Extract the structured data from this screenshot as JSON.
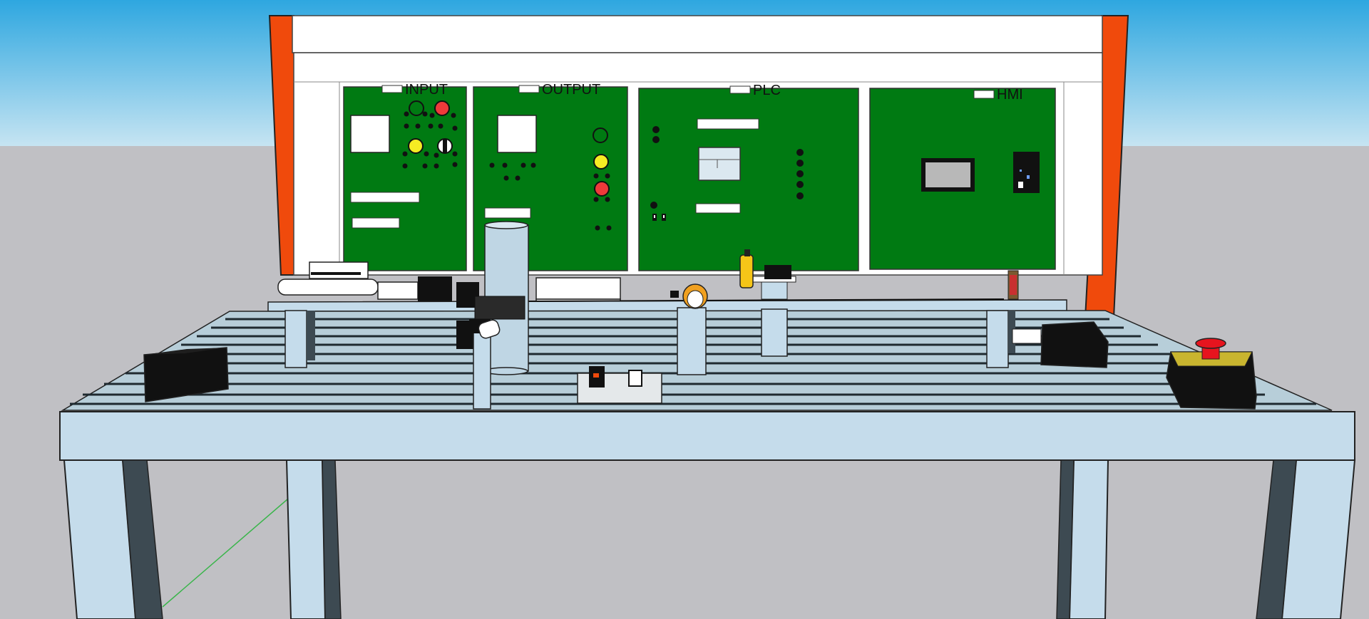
{
  "panels": [
    {
      "id": "input",
      "label": "INPUT"
    },
    {
      "id": "output",
      "label": "OUTPUT"
    },
    {
      "id": "plc",
      "label": "PLC"
    },
    {
      "id": "hmi",
      "label": "HMI"
    }
  ],
  "colors": {
    "sky_top": "#2ea7e0",
    "sky_bottom": "#bfe0f0",
    "ground": "#c0c0c4",
    "board_frame_side": "#f04a0c",
    "board_white": "#ffffff",
    "panel_green": "#007a12",
    "table_light": "#c5dceb",
    "table_dark": "#3d4a52",
    "lamp_red": "#ee3a3a",
    "lamp_yellow": "#f5ec23",
    "emergency_red": "#e6141e",
    "emergency_base": "#c9b52f"
  },
  "icons": [
    "green-pilot-lamp-icon",
    "red-pilot-lamp-icon",
    "yellow-pilot-lamp-icon",
    "selector-switch-icon",
    "emergency-stop-icon",
    "hmi-screen-icon"
  ]
}
